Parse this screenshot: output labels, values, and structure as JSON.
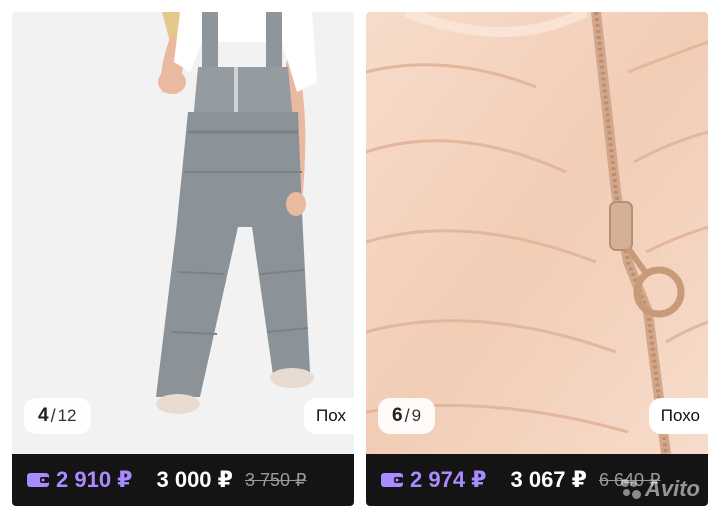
{
  "listings": [
    {
      "counter": {
        "current": "4",
        "separator": "/",
        "total": "12"
      },
      "similar_label": "Пох",
      "price_wallet": "2 910 ₽",
      "price": "3 000 ₽",
      "price_old": "3 750 ₽",
      "image_icon": "kids-snow-overalls-gray-photo"
    },
    {
      "counter": {
        "current": "6",
        "separator": "/",
        "total": "9"
      },
      "similar_label": "Похо",
      "price_wallet": "2 974 ₽",
      "price": "3 067 ₽",
      "price_old": "6 640 ₽",
      "image_icon": "peach-puffer-jacket-zipper-photo"
    }
  ],
  "watermark": "Avito",
  "colors": {
    "wallet_price": "#a98bff",
    "price_bar": "#141414",
    "old_price": "#9a9a9a"
  }
}
